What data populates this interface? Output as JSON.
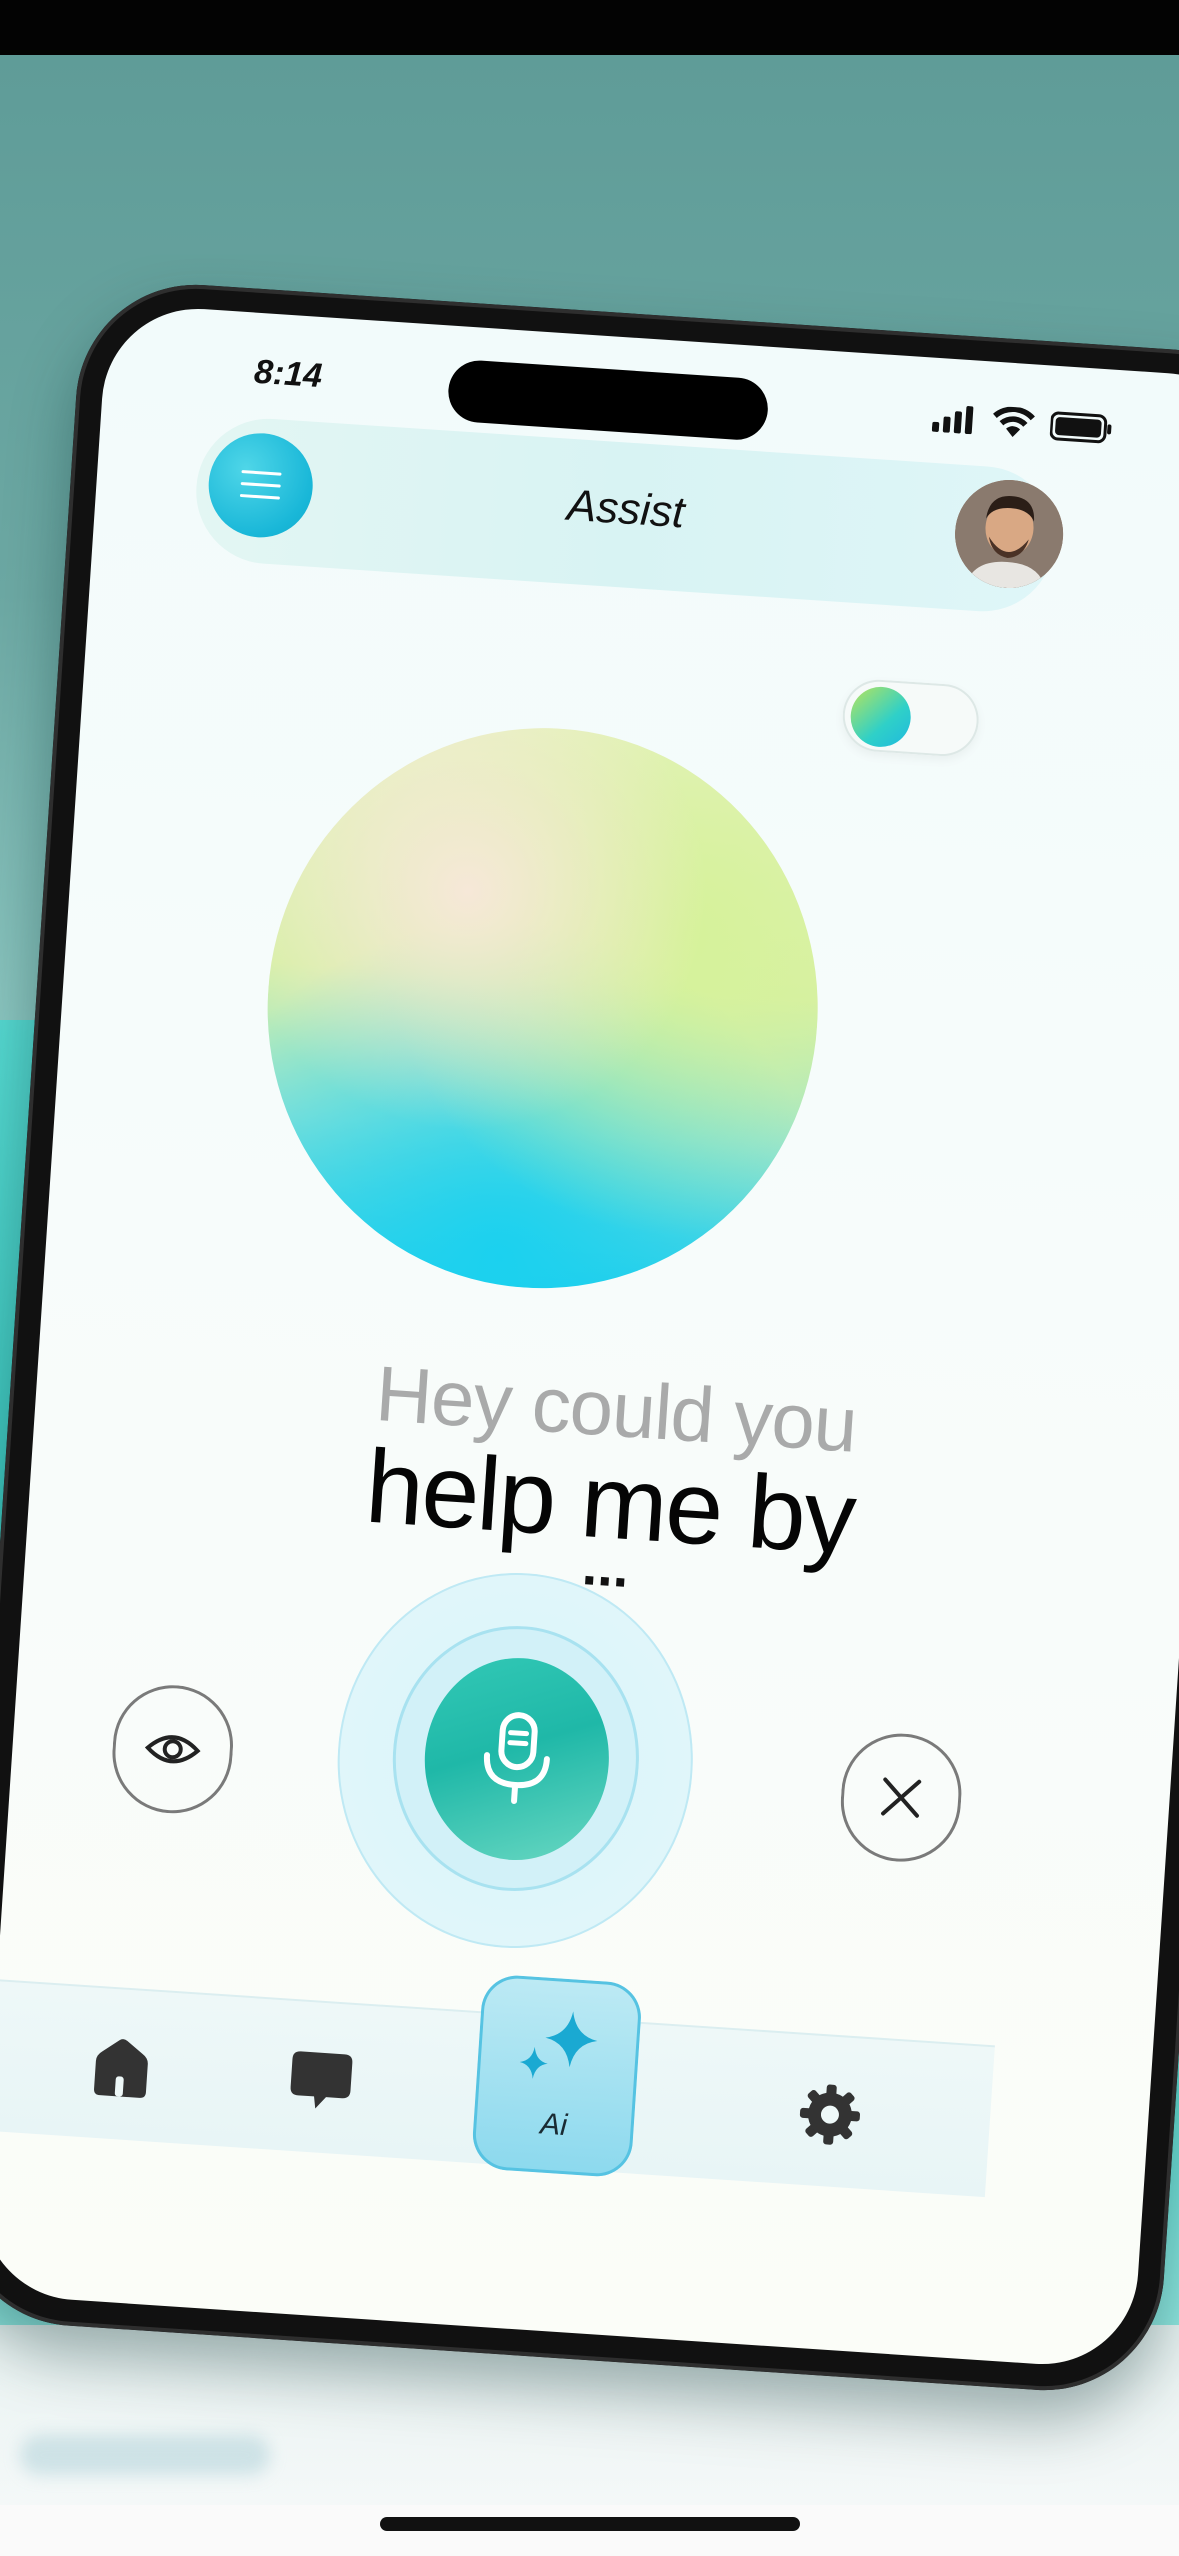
{
  "status_bar": {
    "time": "8:14"
  },
  "header": {
    "title": "Assist"
  },
  "prompt": {
    "line1": "Hey could you",
    "line2": "help me by",
    "ellipsis": "..."
  },
  "tab_bar": {
    "ai_label": "Ai"
  },
  "colors": {
    "accent_teal": "#1fb8a8",
    "accent_cyan": "#19b7d8",
    "background": "#f4fbfa"
  }
}
